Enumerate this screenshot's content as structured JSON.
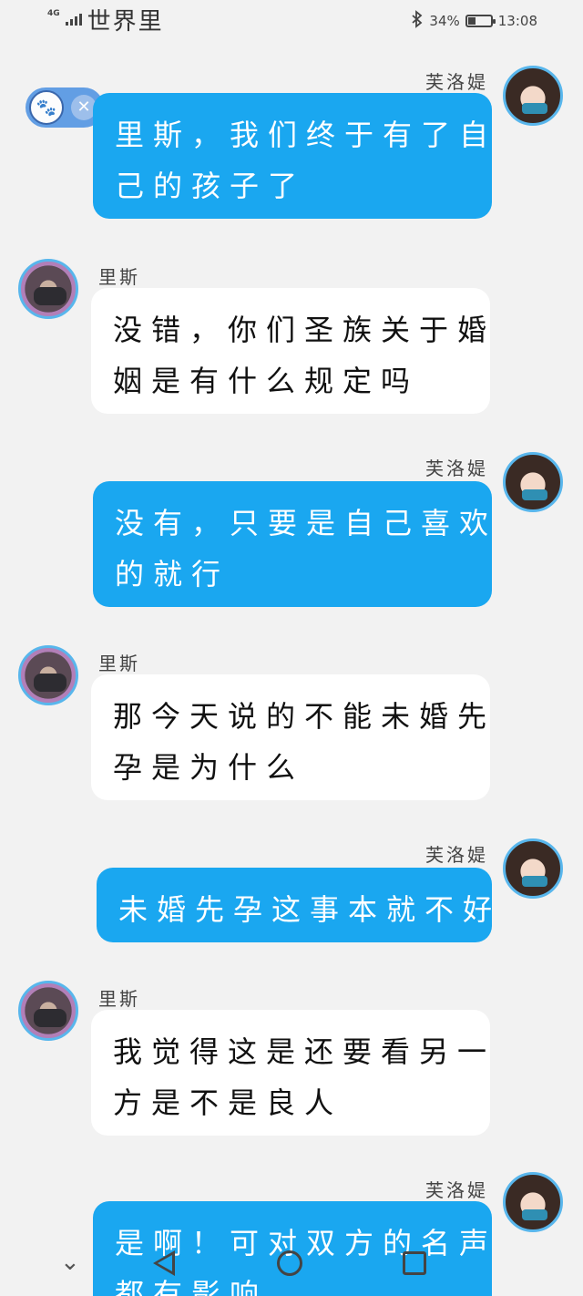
{
  "status_bar": {
    "network": "4G",
    "carrier": "世界里",
    "battery_percent": "34%",
    "battery_level": 0.34,
    "time": "13:08"
  },
  "chat": {
    "participants": {
      "right_name": "芙洛媞",
      "left_name": "里斯"
    },
    "messages": [
      {
        "sender": "芙洛媞",
        "side": "right",
        "lines": [
          "里斯，我们终于有了自",
          "己的孩子了"
        ]
      },
      {
        "sender": "里斯",
        "side": "left",
        "lines": [
          "没错，你们圣族关于婚",
          "姻是有什么规定吗"
        ]
      },
      {
        "sender": "芙洛媞",
        "side": "right",
        "lines": [
          "没有，只要是自己喜欢",
          "的就行"
        ]
      },
      {
        "sender": "里斯",
        "side": "left",
        "lines": [
          "那今天说的不能未婚先",
          "孕是为什么"
        ]
      },
      {
        "sender": "芙洛媞",
        "side": "right",
        "lines": [
          "未婚先孕这事本就不好"
        ]
      },
      {
        "sender": "里斯",
        "side": "left",
        "lines": [
          "我觉得这是还要看另一",
          "方是不是良人"
        ]
      },
      {
        "sender": "芙洛媞",
        "side": "right",
        "lines": [
          "是啊！可对双方的名声",
          "都有影响"
        ]
      }
    ]
  },
  "icons": {
    "bluetooth": "bluetooth-icon",
    "battery": "battery-icon",
    "widget": "paw-icon",
    "widget_close": "close-icon",
    "nav_chevron": "chevron-down-icon",
    "nav_back": "back-icon",
    "nav_home": "home-icon",
    "nav_recent": "recent-apps-icon"
  },
  "colors": {
    "background": "#f2f2f2",
    "right_bubble": "#1aa7f0",
    "left_bubble": "#ffffff",
    "avatar_ring": "#58b6ec"
  }
}
